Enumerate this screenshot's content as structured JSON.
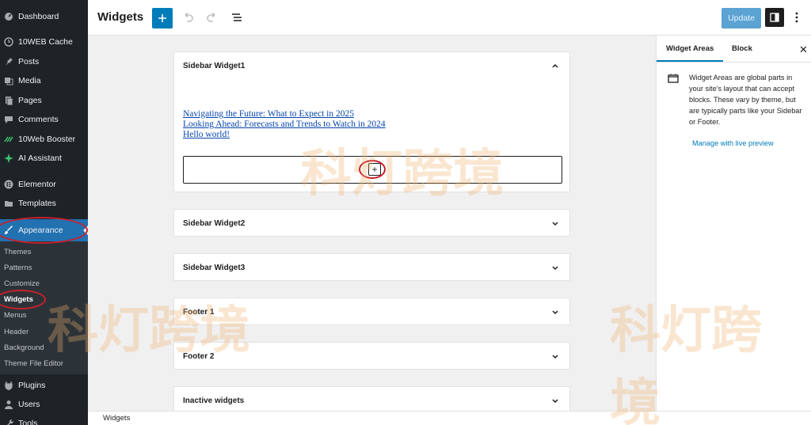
{
  "sidebar": {
    "items": [
      {
        "label": "Dashboard",
        "icon": "dashboard-icon"
      },
      {
        "label": "10WEB Cache",
        "icon": "cache-icon"
      },
      {
        "label": "Posts",
        "icon": "pin-icon"
      },
      {
        "label": "Media",
        "icon": "media-icon"
      },
      {
        "label": "Pages",
        "icon": "pages-icon"
      },
      {
        "label": "Comments",
        "icon": "comment-icon"
      },
      {
        "label": "10Web Booster",
        "icon": "booster-icon"
      },
      {
        "label": "AI Assistant",
        "icon": "sparkle-icon"
      },
      {
        "label": "Elementor",
        "icon": "elementor-icon"
      },
      {
        "label": "Templates",
        "icon": "folder-icon"
      },
      {
        "label": "Appearance",
        "icon": "brush-icon"
      },
      {
        "label": "Plugins",
        "icon": "plugin-icon"
      },
      {
        "label": "Users",
        "icon": "user-icon"
      },
      {
        "label": "Tools",
        "icon": "wrench-icon"
      }
    ],
    "submenu": [
      "Themes",
      "Patterns",
      "Customize",
      "Widgets",
      "Menus",
      "Header",
      "Background",
      "Theme File Editor"
    ]
  },
  "header": {
    "title": "Widgets",
    "update_label": "Update"
  },
  "areas": {
    "sidebar1": {
      "title": "Sidebar Widget1",
      "posts": [
        "Navigating the Future: What to Expect in 2025",
        "Looking Ahead: Forecasts and Trends to Watch in 2024",
        "Hello world!"
      ]
    },
    "sidebar2": {
      "title": "Sidebar Widget2"
    },
    "sidebar3": {
      "title": "Sidebar Widget3"
    },
    "footer1": {
      "title": "Footer 1"
    },
    "footer2": {
      "title": "Footer 2"
    },
    "inactive": {
      "title": "Inactive widgets"
    }
  },
  "panel": {
    "tabs": [
      "Widget Areas",
      "Block"
    ],
    "description": "Widget Areas are global parts in your site's layout that can accept blocks. These vary by theme, but are typically parts like your Sidebar or Footer.",
    "link": "Manage with live preview"
  },
  "footer": {
    "breadcrumb": "Widgets"
  },
  "watermark": {
    "text": "科灯跨境"
  },
  "colors": {
    "accent": "#007cba",
    "sidebar_bg": "#1d2327",
    "active_menu": "#2271b1",
    "annotation": "#c8202c"
  }
}
